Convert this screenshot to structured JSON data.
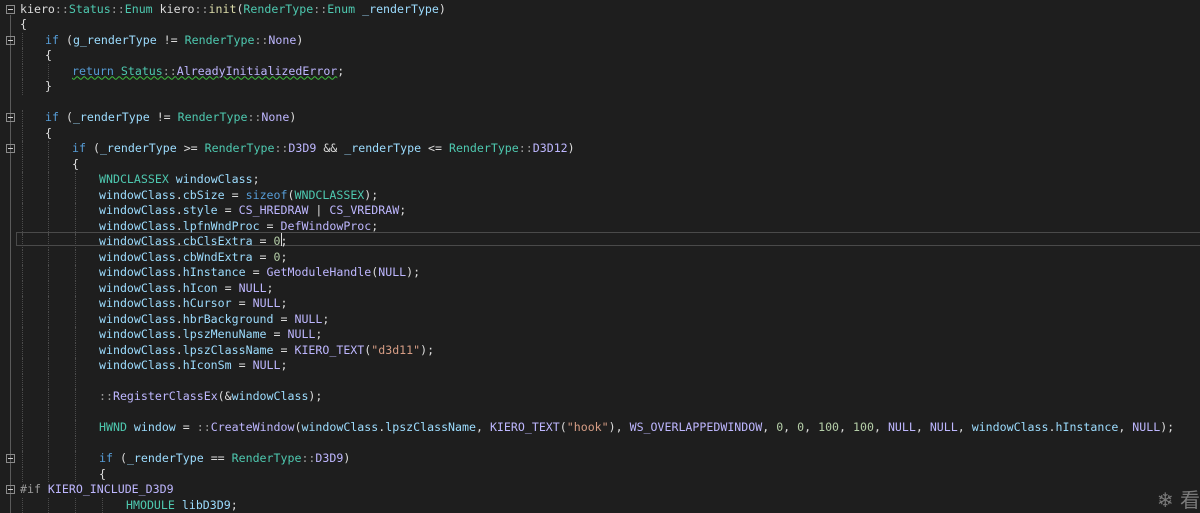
{
  "editor": {
    "lines": [
      {
        "fold": true,
        "indent": 0,
        "tokens": [
          [
            "pl",
            "kiero"
          ],
          [
            "pp",
            "::"
          ],
          [
            "ty",
            "Status"
          ],
          [
            "pp",
            "::"
          ],
          [
            "ty",
            "Enum"
          ],
          [
            "pl",
            " kiero"
          ],
          [
            "pp",
            "::"
          ],
          [
            "fn",
            "init"
          ],
          [
            "pl",
            "("
          ],
          [
            "ty",
            "RenderType"
          ],
          [
            "pp",
            "::"
          ],
          [
            "ty",
            "Enum"
          ],
          [
            "pl",
            " "
          ],
          [
            "var",
            "_renderType"
          ],
          [
            "pl",
            ")"
          ]
        ]
      },
      {
        "fold": false,
        "indent": 0,
        "tokens": [
          [
            "pl",
            "{"
          ]
        ]
      },
      {
        "fold": true,
        "indent": 1,
        "tokens": [
          [
            "kw",
            "if"
          ],
          [
            "pl",
            " ("
          ],
          [
            "var",
            "g_renderType"
          ],
          [
            "pl",
            " != "
          ],
          [
            "ty",
            "RenderType"
          ],
          [
            "pp",
            "::"
          ],
          [
            "mac",
            "None"
          ],
          [
            "pl",
            ")"
          ]
        ]
      },
      {
        "fold": false,
        "indent": 1,
        "tokens": [
          [
            "pl",
            "{"
          ]
        ]
      },
      {
        "fold": false,
        "indent": 2,
        "tokens": [
          [
            "kw sq",
            "return "
          ],
          [
            "ty sq",
            "Status"
          ],
          [
            "pp sq",
            "::"
          ],
          [
            "mac sq",
            "AlreadyInitializedError"
          ],
          [
            "pl",
            ";"
          ]
        ]
      },
      {
        "fold": false,
        "indent": 1,
        "tokens": [
          [
            "pl",
            "}"
          ]
        ]
      },
      {
        "fold": false,
        "indent": 0,
        "tokens": []
      },
      {
        "fold": true,
        "indent": 1,
        "tokens": [
          [
            "kw",
            "if"
          ],
          [
            "pl",
            " ("
          ],
          [
            "var",
            "_renderType"
          ],
          [
            "pl",
            " != "
          ],
          [
            "ty",
            "RenderType"
          ],
          [
            "pp",
            "::"
          ],
          [
            "mac",
            "None"
          ],
          [
            "pl",
            ")"
          ]
        ]
      },
      {
        "fold": false,
        "indent": 1,
        "tokens": [
          [
            "pl",
            "{"
          ]
        ]
      },
      {
        "fold": true,
        "indent": 2,
        "tokens": [
          [
            "kw",
            "if"
          ],
          [
            "pl",
            " ("
          ],
          [
            "var",
            "_renderType"
          ],
          [
            "pl",
            " >= "
          ],
          [
            "ty",
            "RenderType"
          ],
          [
            "pp",
            "::"
          ],
          [
            "mac",
            "D3D9"
          ],
          [
            "pl",
            " && "
          ],
          [
            "var",
            "_renderType"
          ],
          [
            "pl",
            " <= "
          ],
          [
            "ty",
            "RenderType"
          ],
          [
            "pp",
            "::"
          ],
          [
            "mac",
            "D3D12"
          ],
          [
            "pl",
            ")"
          ]
        ]
      },
      {
        "fold": false,
        "indent": 2,
        "tokens": [
          [
            "pl",
            "{"
          ]
        ]
      },
      {
        "fold": false,
        "indent": 3,
        "tokens": [
          [
            "ty",
            "WNDCLASSEX"
          ],
          [
            "pl",
            " "
          ],
          [
            "var",
            "windowClass"
          ],
          [
            "pl",
            ";"
          ]
        ]
      },
      {
        "fold": false,
        "indent": 3,
        "tokens": [
          [
            "var",
            "windowClass"
          ],
          [
            "pl",
            "."
          ],
          [
            "var",
            "cbSize"
          ],
          [
            "pl",
            " = "
          ],
          [
            "kw",
            "sizeof"
          ],
          [
            "pl",
            "("
          ],
          [
            "ty",
            "WNDCLASSEX"
          ],
          [
            "pl",
            ");"
          ]
        ]
      },
      {
        "fold": false,
        "indent": 3,
        "tokens": [
          [
            "var",
            "windowClass"
          ],
          [
            "pl",
            "."
          ],
          [
            "var",
            "style"
          ],
          [
            "pl",
            " = "
          ],
          [
            "mac",
            "CS_HREDRAW"
          ],
          [
            "pl",
            " | "
          ],
          [
            "mac",
            "CS_VREDRAW"
          ],
          [
            "pl",
            ";"
          ]
        ]
      },
      {
        "fold": false,
        "indent": 3,
        "tokens": [
          [
            "var",
            "windowClass"
          ],
          [
            "pl",
            "."
          ],
          [
            "var",
            "lpfnWndProc"
          ],
          [
            "pl",
            " = "
          ],
          [
            "mac",
            "DefWindowProc"
          ],
          [
            "pl",
            ";"
          ]
        ]
      },
      {
        "fold": false,
        "indent": 3,
        "tokens": [
          [
            "var",
            "windowClass"
          ],
          [
            "pl",
            "."
          ],
          [
            "var",
            "cbClsExtra"
          ],
          [
            "pl",
            " = "
          ],
          [
            "num",
            "0"
          ],
          [
            "pl",
            ";"
          ]
        ]
      },
      {
        "fold": false,
        "indent": 3,
        "tokens": [
          [
            "var",
            "windowClass"
          ],
          [
            "pl",
            "."
          ],
          [
            "var",
            "cbWndExtra"
          ],
          [
            "pl",
            " = "
          ],
          [
            "num",
            "0"
          ],
          [
            "pl",
            ";"
          ]
        ]
      },
      {
        "fold": false,
        "indent": 3,
        "tokens": [
          [
            "var",
            "windowClass"
          ],
          [
            "pl",
            "."
          ],
          [
            "var",
            "hInstance"
          ],
          [
            "pl",
            " = "
          ],
          [
            "mac",
            "GetModuleHandle"
          ],
          [
            "pl",
            "("
          ],
          [
            "mac",
            "NULL"
          ],
          [
            "pl",
            ");"
          ]
        ]
      },
      {
        "fold": false,
        "indent": 3,
        "tokens": [
          [
            "var",
            "windowClass"
          ],
          [
            "pl",
            "."
          ],
          [
            "var",
            "hIcon"
          ],
          [
            "pl",
            " = "
          ],
          [
            "mac",
            "NULL"
          ],
          [
            "pl",
            ";"
          ]
        ]
      },
      {
        "fold": false,
        "indent": 3,
        "tokens": [
          [
            "var",
            "windowClass"
          ],
          [
            "pl",
            "."
          ],
          [
            "var",
            "hCursor"
          ],
          [
            "pl",
            " = "
          ],
          [
            "mac",
            "NULL"
          ],
          [
            "pl",
            ";"
          ]
        ]
      },
      {
        "fold": false,
        "indent": 3,
        "tokens": [
          [
            "var",
            "windowClass"
          ],
          [
            "pl",
            "."
          ],
          [
            "var",
            "hbrBackground"
          ],
          [
            "pl",
            " = "
          ],
          [
            "mac",
            "NULL"
          ],
          [
            "pl",
            ";"
          ]
        ]
      },
      {
        "fold": false,
        "indent": 3,
        "tokens": [
          [
            "var",
            "windowClass"
          ],
          [
            "pl",
            "."
          ],
          [
            "var",
            "lpszMenuName"
          ],
          [
            "pl",
            " = "
          ],
          [
            "mac",
            "NULL"
          ],
          [
            "pl",
            ";"
          ]
        ]
      },
      {
        "fold": false,
        "indent": 3,
        "tokens": [
          [
            "var",
            "windowClass"
          ],
          [
            "pl",
            "."
          ],
          [
            "var",
            "lpszClassName"
          ],
          [
            "pl",
            " = "
          ],
          [
            "mac",
            "KIERO_TEXT"
          ],
          [
            "pl",
            "("
          ],
          [
            "str",
            "\"d3d11\""
          ],
          [
            "pl",
            ");"
          ]
        ]
      },
      {
        "fold": false,
        "indent": 3,
        "tokens": [
          [
            "var",
            "windowClass"
          ],
          [
            "pl",
            "."
          ],
          [
            "var",
            "hIconSm"
          ],
          [
            "pl",
            " = "
          ],
          [
            "mac",
            "NULL"
          ],
          [
            "pl",
            ";"
          ]
        ]
      },
      {
        "fold": false,
        "indent": 3,
        "tokens": []
      },
      {
        "fold": false,
        "indent": 3,
        "tokens": [
          [
            "pp",
            "::"
          ],
          [
            "mac",
            "RegisterClassEx"
          ],
          [
            "pl",
            "(&"
          ],
          [
            "var",
            "windowClass"
          ],
          [
            "pl",
            ");"
          ]
        ]
      },
      {
        "fold": false,
        "indent": 3,
        "tokens": []
      },
      {
        "fold": false,
        "indent": 3,
        "tokens": [
          [
            "ty",
            "HWND"
          ],
          [
            "pl",
            " "
          ],
          [
            "var",
            "window"
          ],
          [
            "pl",
            " = "
          ],
          [
            "pp",
            "::"
          ],
          [
            "mac",
            "CreateWindow"
          ],
          [
            "pl",
            "("
          ],
          [
            "var",
            "windowClass"
          ],
          [
            "pl",
            "."
          ],
          [
            "var",
            "lpszClassName"
          ],
          [
            "pl",
            ", "
          ],
          [
            "mac",
            "KIERO_TEXT"
          ],
          [
            "pl",
            "("
          ],
          [
            "str",
            "\"hook\""
          ],
          [
            "pl",
            "), "
          ],
          [
            "mac",
            "WS_OVERLAPPEDWINDOW"
          ],
          [
            "pl",
            ", "
          ],
          [
            "num",
            "0"
          ],
          [
            "pl",
            ", "
          ],
          [
            "num",
            "0"
          ],
          [
            "pl",
            ", "
          ],
          [
            "num",
            "100"
          ],
          [
            "pl",
            ", "
          ],
          [
            "num",
            "100"
          ],
          [
            "pl",
            ", "
          ],
          [
            "mac",
            "NULL"
          ],
          [
            "pl",
            ", "
          ],
          [
            "mac",
            "NULL"
          ],
          [
            "pl",
            ", "
          ],
          [
            "var",
            "windowClass"
          ],
          [
            "pl",
            "."
          ],
          [
            "var",
            "hInstance"
          ],
          [
            "pl",
            ", "
          ],
          [
            "mac",
            "NULL"
          ],
          [
            "pl",
            ");"
          ]
        ]
      },
      {
        "fold": false,
        "indent": 3,
        "tokens": []
      },
      {
        "fold": true,
        "indent": 3,
        "tokens": [
          [
            "kw",
            "if"
          ],
          [
            "pl",
            " ("
          ],
          [
            "var",
            "_renderType"
          ],
          [
            "pl",
            " == "
          ],
          [
            "ty",
            "RenderType"
          ],
          [
            "pp",
            "::"
          ],
          [
            "mac",
            "D3D9"
          ],
          [
            "pl",
            ")"
          ]
        ]
      },
      {
        "fold": false,
        "indent": 3,
        "tokens": [
          [
            "pl",
            "{"
          ]
        ]
      },
      {
        "fold": true,
        "indent": 0,
        "tokens": [
          [
            "pp",
            "#if "
          ],
          [
            "mac",
            "KIERO_INCLUDE_D3D9"
          ]
        ]
      },
      {
        "fold": false,
        "indent": 4,
        "tokens": [
          [
            "ty",
            "HMODULE"
          ],
          [
            "pl",
            " "
          ],
          [
            "var",
            "libD3D9"
          ],
          [
            "pl",
            ";"
          ]
        ]
      }
    ]
  },
  "watermark": {
    "text": "❄ 看"
  }
}
